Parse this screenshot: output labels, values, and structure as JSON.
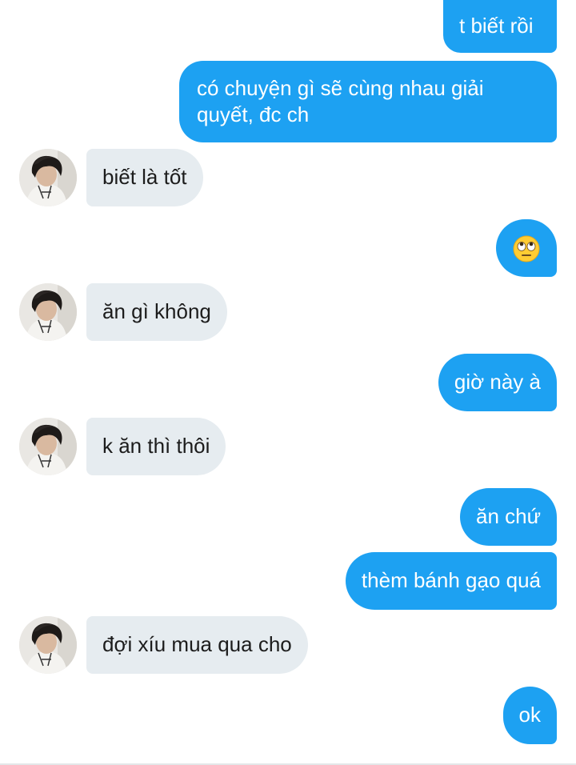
{
  "colors": {
    "outgoing_bubble": "#1da1f2",
    "incoming_bubble": "#e6ecf0",
    "outgoing_text": "#ffffff",
    "incoming_text": "#1c1c1c"
  },
  "messages": [
    {
      "direction": "out",
      "text": "t biết rồi"
    },
    {
      "direction": "out",
      "text": "có chuyện gì sẽ cùng nhau giải quyết, đc ch"
    },
    {
      "direction": "in",
      "text": "biết là tốt"
    },
    {
      "direction": "out",
      "text": "",
      "emoji": "face-with-rolling-eyes-emoji"
    },
    {
      "direction": "in",
      "text": "ăn gì không"
    },
    {
      "direction": "out",
      "text": "giờ này à"
    },
    {
      "direction": "in",
      "text": "k ăn thì thôi"
    },
    {
      "direction": "out",
      "text": "ăn chứ"
    },
    {
      "direction": "out",
      "text": "thèm bánh gạo quá"
    },
    {
      "direction": "in",
      "text": "đợi xíu mua qua cho"
    },
    {
      "direction": "out",
      "text": "ok"
    }
  ]
}
